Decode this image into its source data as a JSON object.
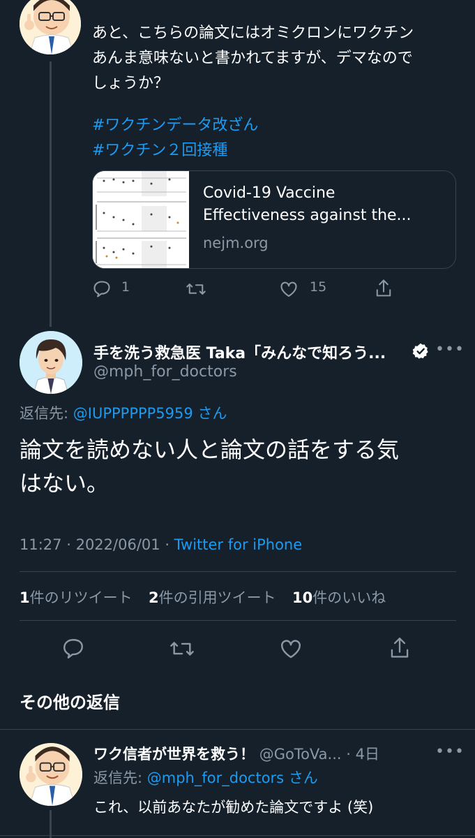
{
  "prev_tweet": {
    "text_line1": "あと、こちらの論文にはオミクロンにワクチン",
    "text_line2": "あんま意味ないと書かれてますが、デマなので",
    "text_line3": "しょうか？",
    "hashtag1": "#ワクチンデータ改ざん",
    "hashtag2": "#ワクチン２回接種",
    "card": {
      "title_line1": "Covid-19 Vaccine",
      "title_line2": "Effectiveness against the...",
      "domain": "nejm.org"
    },
    "reply_count": "1",
    "like_count": "15"
  },
  "main_tweet": {
    "display_name": "手を洗う救急医 Taka「みんなで知ろう...",
    "handle": "@mph_for_doctors",
    "reply_to_label": "返信先:",
    "reply_to_handle": "@IUPPPPPP5959",
    "reply_to_suffix": "さん",
    "text_line1": "論文を読めない人と論文の話をする気",
    "text_line2": "はない。",
    "time": "11:27",
    "date": "2022/06/01",
    "source": "Twitter for iPhone",
    "stats": {
      "retweets_num": "1",
      "retweets_label": "件のリツイート",
      "quotes_num": "2",
      "quotes_label": "件の引用ツイート",
      "likes_num": "10",
      "likes_label": "件のいいね"
    }
  },
  "more_replies_heading": "その他の返信",
  "reply_tweet": {
    "display_name": "ワク信者が世界を救う！",
    "handle": "@GoToVa...",
    "time": "4日",
    "reply_to_label": "返信先:",
    "reply_to_handle": "@mph_for_doctors",
    "reply_to_suffix": "さん",
    "text": "これ、以前あなたが勧めた論文ですよ (笑)"
  },
  "colors": {
    "background": "#15202b",
    "accent": "#1d9bf0",
    "muted": "#8b98a5",
    "divider": "#38444d"
  }
}
